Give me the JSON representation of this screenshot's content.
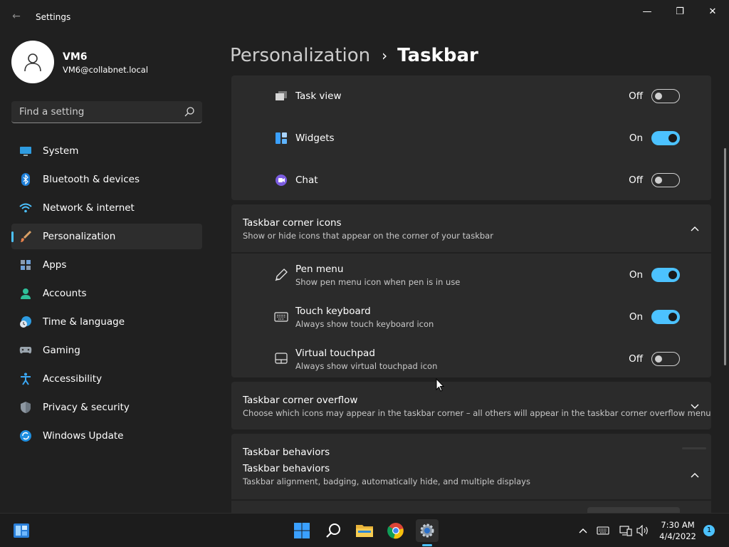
{
  "window": {
    "title": "Settings",
    "back_glyph": "←",
    "minimize_glyph": "—",
    "maximize_glyph": "❐",
    "close_glyph": "✕"
  },
  "user": {
    "name": "VM6",
    "email": "VM6@collabnet.local"
  },
  "search": {
    "placeholder": "Find a setting"
  },
  "sidebar": {
    "items": [
      {
        "label": "System",
        "icon": "monitor-icon"
      },
      {
        "label": "Bluetooth & devices",
        "icon": "bluetooth-icon"
      },
      {
        "label": "Network & internet",
        "icon": "wifi-icon"
      },
      {
        "label": "Personalization",
        "icon": "brush-icon",
        "active": true
      },
      {
        "label": "Apps",
        "icon": "apps-icon"
      },
      {
        "label": "Accounts",
        "icon": "person-icon"
      },
      {
        "label": "Time & language",
        "icon": "clock-globe-icon"
      },
      {
        "label": "Gaming",
        "icon": "gamepad-icon"
      },
      {
        "label": "Accessibility",
        "icon": "accessibility-icon"
      },
      {
        "label": "Privacy & security",
        "icon": "shield-icon"
      },
      {
        "label": "Windows Update",
        "icon": "update-icon"
      }
    ]
  },
  "breadcrumb": {
    "parent": "Personalization",
    "separator": "›",
    "current": "Taskbar"
  },
  "taskbar_items": [
    {
      "title": "Task view",
      "state": "Off",
      "on": false,
      "icon": "task-view-icon"
    },
    {
      "title": "Widgets",
      "state": "On",
      "on": true,
      "icon": "widgets-icon"
    },
    {
      "title": "Chat",
      "state": "Off",
      "on": false,
      "icon": "chat-icon"
    }
  ],
  "corner_icons": {
    "title": "Taskbar corner icons",
    "subtitle": "Show or hide icons that appear on the corner of your taskbar",
    "items": [
      {
        "title": "Pen menu",
        "subtitle": "Show pen menu icon when pen is in use",
        "state": "On",
        "on": true,
        "icon": "pen-icon"
      },
      {
        "title": "Touch keyboard",
        "subtitle": "Always show touch keyboard icon",
        "state": "On",
        "on": true,
        "icon": "keyboard-icon"
      },
      {
        "title": "Virtual touchpad",
        "subtitle": "Always show virtual touchpad icon",
        "state": "Off",
        "on": false,
        "icon": "touchpad-icon"
      }
    ]
  },
  "corner_overflow": {
    "title": "Taskbar corner overflow",
    "subtitle": "Choose which icons may appear in the taskbar corner – all others will appear in the taskbar corner overflow menu"
  },
  "behaviors": {
    "ghost_title": "Taskbar behaviors",
    "title": "Taskbar behaviors",
    "subtitle": "Taskbar alignment, badging, automatically hide, and multiple displays"
  },
  "clock": {
    "time": "7:30 AM",
    "date": "4/4/2022"
  },
  "notifications": {
    "count": "1"
  },
  "colors": {
    "accent": "#4cc2ff",
    "background": "#202020",
    "card": "#2b2b2b"
  }
}
